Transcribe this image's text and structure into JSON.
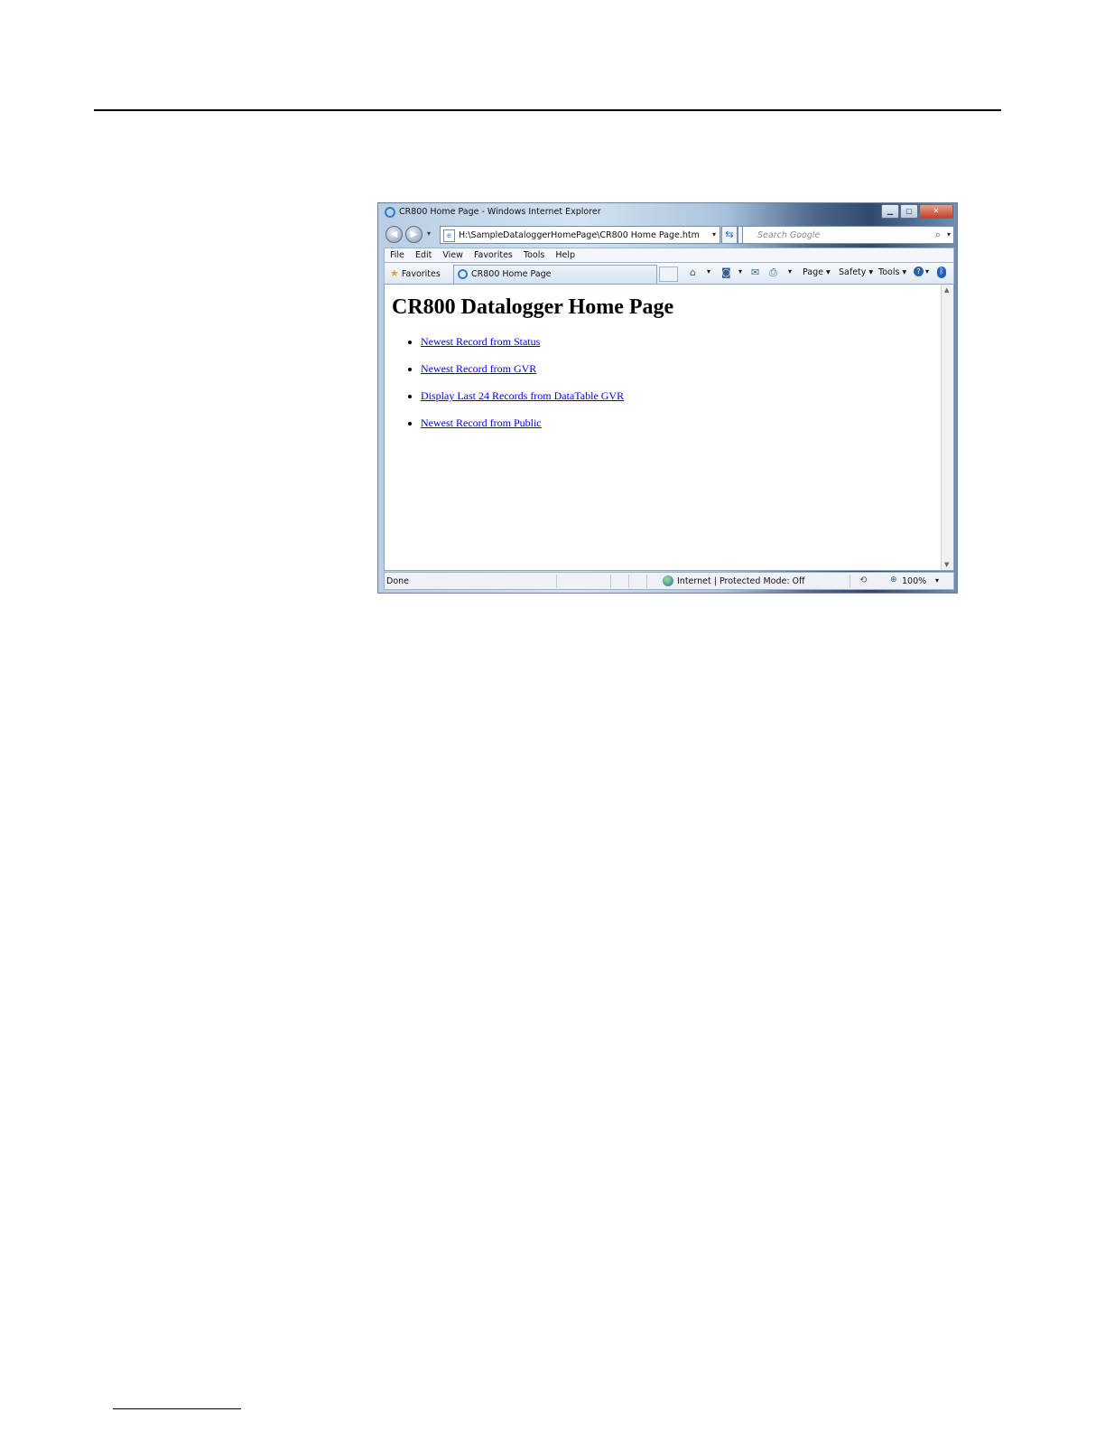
{
  "window": {
    "title": "CR800 Home Page - Windows Internet Explorer",
    "controls": {
      "minimize": "▁",
      "maximize": "▢",
      "close": "✕"
    }
  },
  "navigation": {
    "back": "◀",
    "forward": "▶",
    "history": "▾",
    "address": "H:\\SampleDataloggerHomePage\\CR800 Home Page.htm",
    "address_dropdown": "▾",
    "refresh": "⇆",
    "stop": "✕",
    "search_placeholder": "Search Google",
    "search_icon": "⌕",
    "search_dropdown": "▾"
  },
  "menu": [
    "File",
    "Edit",
    "View",
    "Favorites",
    "Tools",
    "Help"
  ],
  "favorites_bar": {
    "favorites_label": "Favorites",
    "favorites_icon": "★",
    "tab_label": "CR800 Home Page"
  },
  "command_bar": {
    "home_icon": "⌂",
    "feeds_icon": "◙",
    "mail_icon": "✉",
    "print_icon": "⎙",
    "page": "Page ▾",
    "safety": "Safety ▾",
    "tools": "Tools ▾",
    "help_icon": "?",
    "bluetooth_icon": "ᛒ",
    "dropdown": "▾"
  },
  "page": {
    "heading": "CR800 Datalogger Home Page",
    "links": [
      "Newest Record from Status",
      "Newest Record from GVR",
      "Display Last 24 Records from DataTable GVR",
      "Newest Record from Public"
    ]
  },
  "status_bar": {
    "status": "Done",
    "zone": "Internet | Protected Mode: Off",
    "zoom": "100%",
    "zoom_dropdown": "▾"
  },
  "scroll": {
    "up": "▲",
    "down": "▼"
  }
}
